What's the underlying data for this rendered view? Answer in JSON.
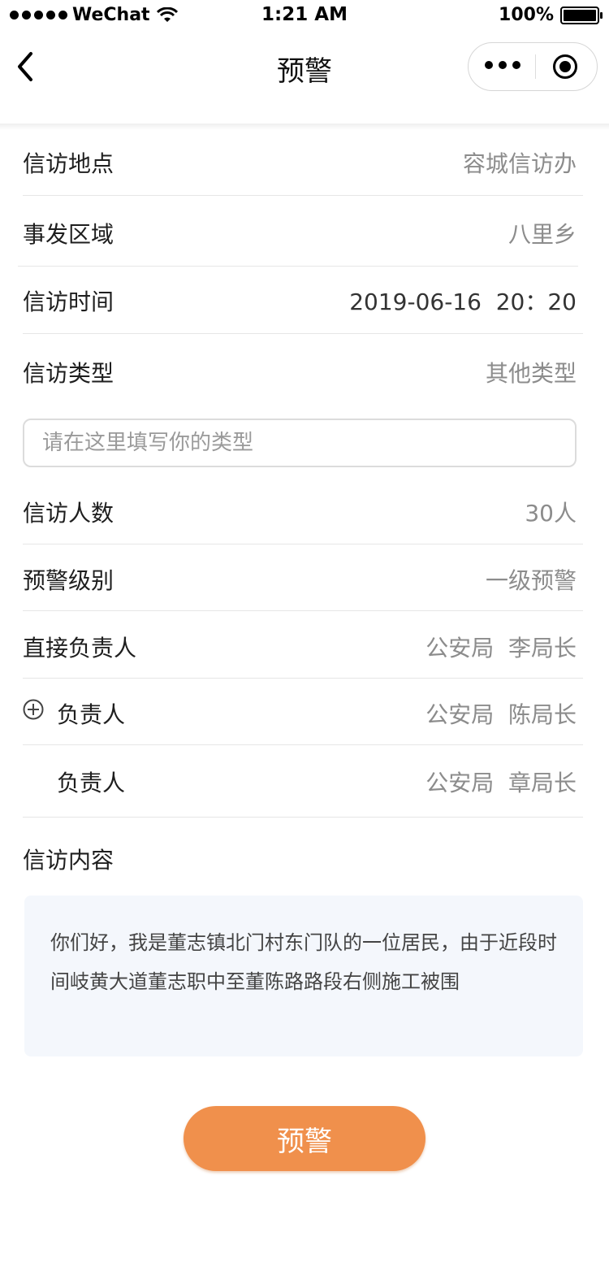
{
  "status_bar": {
    "carrier": "WeChat",
    "time": "1:21 AM",
    "battery": "100%"
  },
  "nav": {
    "title": "预警"
  },
  "form": {
    "location": {
      "label": "信访地点",
      "value": "容城信访办"
    },
    "area": {
      "label": "事发区域",
      "value": "八里乡"
    },
    "time": {
      "label": "信访时间",
      "value": "2019-06-16  20：20"
    },
    "type": {
      "label": "信访类型",
      "value": "其他类型"
    },
    "type_input_placeholder": "请在这里填写你的类型",
    "count": {
      "label": "信访人数",
      "value": "30人"
    },
    "level": {
      "label": "预警级别",
      "value": "一级预警"
    },
    "direct_person": {
      "label": "直接负责人",
      "value": "公安局  李局长"
    },
    "persons": [
      {
        "label": "负责人",
        "value": "公安局  陈局长"
      },
      {
        "label": "负责人",
        "value": "公安局  章局长"
      }
    ],
    "content_label": "信访内容",
    "content_text": "你们好，我是董志镇北门村东门队的一位居民，由于近段时间岐黄大道董志职中至董陈路路段右侧施工被围"
  },
  "submit_label": "预警",
  "colors": {
    "accent": "#f0904c",
    "content_bg": "#f4f7fc",
    "value_gray": "#8c8c8c"
  }
}
